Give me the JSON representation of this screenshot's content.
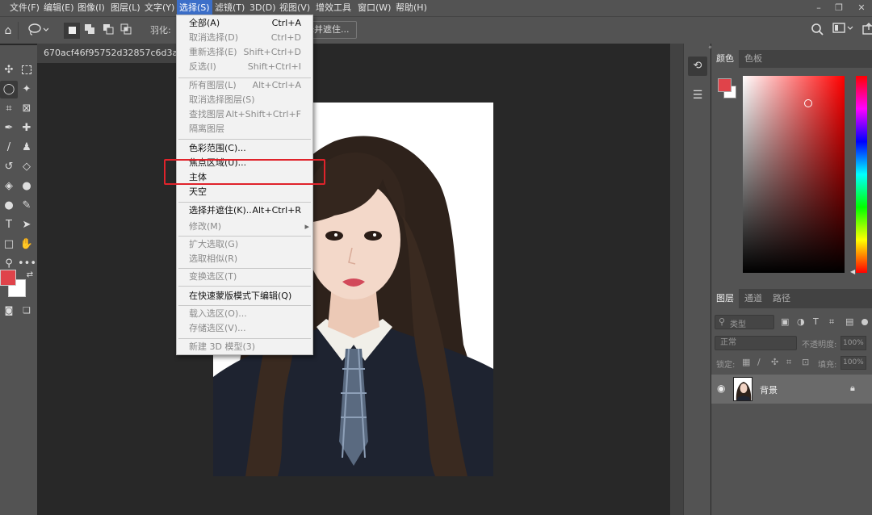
{
  "menubar": {
    "items": [
      "文件(F)",
      "编辑(E)",
      "图像(I)",
      "图层(L)",
      "文字(Y)",
      "选择(S)",
      "滤镜(T)",
      "3D(D)",
      "视图(V)",
      "增效工具",
      "窗口(W)",
      "帮助(H)"
    ],
    "active_index": 5
  },
  "options_bar": {
    "feather_label": "羽化:",
    "select_mask_button": "选择并遮住..."
  },
  "document": {
    "tab_title": "670acf46f95752d32857c6d3a4905fe"
  },
  "colors": {
    "foreground": "#e0434a",
    "background": "#ffffff",
    "accent": "#3c6fc9",
    "highlight_box": "#e0232b"
  },
  "select_menu": {
    "items": [
      {
        "label": "全部(A)",
        "shortcut": "Ctrl+A",
        "enabled": true
      },
      {
        "label": "取消选择(D)",
        "shortcut": "Ctrl+D",
        "enabled": false
      },
      {
        "label": "重新选择(E)",
        "shortcut": "Shift+Ctrl+D",
        "enabled": false
      },
      {
        "label": "反选(I)",
        "shortcut": "Shift+Ctrl+I",
        "enabled": false
      },
      {
        "label": "所有图层(L)",
        "shortcut": "Alt+Ctrl+A",
        "enabled": false
      },
      {
        "label": "取消选择图层(S)",
        "shortcut": "",
        "enabled": false
      },
      {
        "label": "查找图层",
        "shortcut": "Alt+Shift+Ctrl+F",
        "enabled": false
      },
      {
        "label": "隔离图层",
        "shortcut": "",
        "enabled": false
      },
      {
        "label": "色彩范围(C)...",
        "shortcut": "",
        "enabled": true
      },
      {
        "label": "焦点区域(U)...",
        "shortcut": "",
        "enabled": true
      },
      {
        "label": "主体",
        "shortcut": "",
        "enabled": true
      },
      {
        "label": "天空",
        "shortcut": "",
        "enabled": true
      },
      {
        "label": "选择并遮住(K)...",
        "shortcut": "Alt+Ctrl+R",
        "enabled": true
      },
      {
        "label": "修改(M)",
        "shortcut": "",
        "enabled": false,
        "submenu": true
      },
      {
        "label": "扩大选取(G)",
        "shortcut": "",
        "enabled": false
      },
      {
        "label": "选取相似(R)",
        "shortcut": "",
        "enabled": false
      },
      {
        "label": "变换选区(T)",
        "shortcut": "",
        "enabled": false
      },
      {
        "label": "在快速蒙版模式下编辑(Q)",
        "shortcut": "",
        "enabled": true
      },
      {
        "label": "载入选区(O)...",
        "shortcut": "",
        "enabled": false
      },
      {
        "label": "存储选区(V)...",
        "shortcut": "",
        "enabled": false
      },
      {
        "label": "新建 3D 模型(3)",
        "shortcut": "",
        "enabled": false
      }
    ]
  },
  "color_panel": {
    "tabs": [
      "颜色",
      "色板"
    ]
  },
  "layers_panel": {
    "tabs": [
      "图层",
      "通道",
      "路径"
    ],
    "filter_placeholder": "类型",
    "blend_mode": "正常",
    "opacity_label": "不透明度:",
    "opacity_value": "100%",
    "lock_label": "锁定:",
    "fill_label": "填充:",
    "fill_value": "100%",
    "layers": [
      {
        "name": "背景",
        "visible": true,
        "locked": true
      }
    ]
  }
}
